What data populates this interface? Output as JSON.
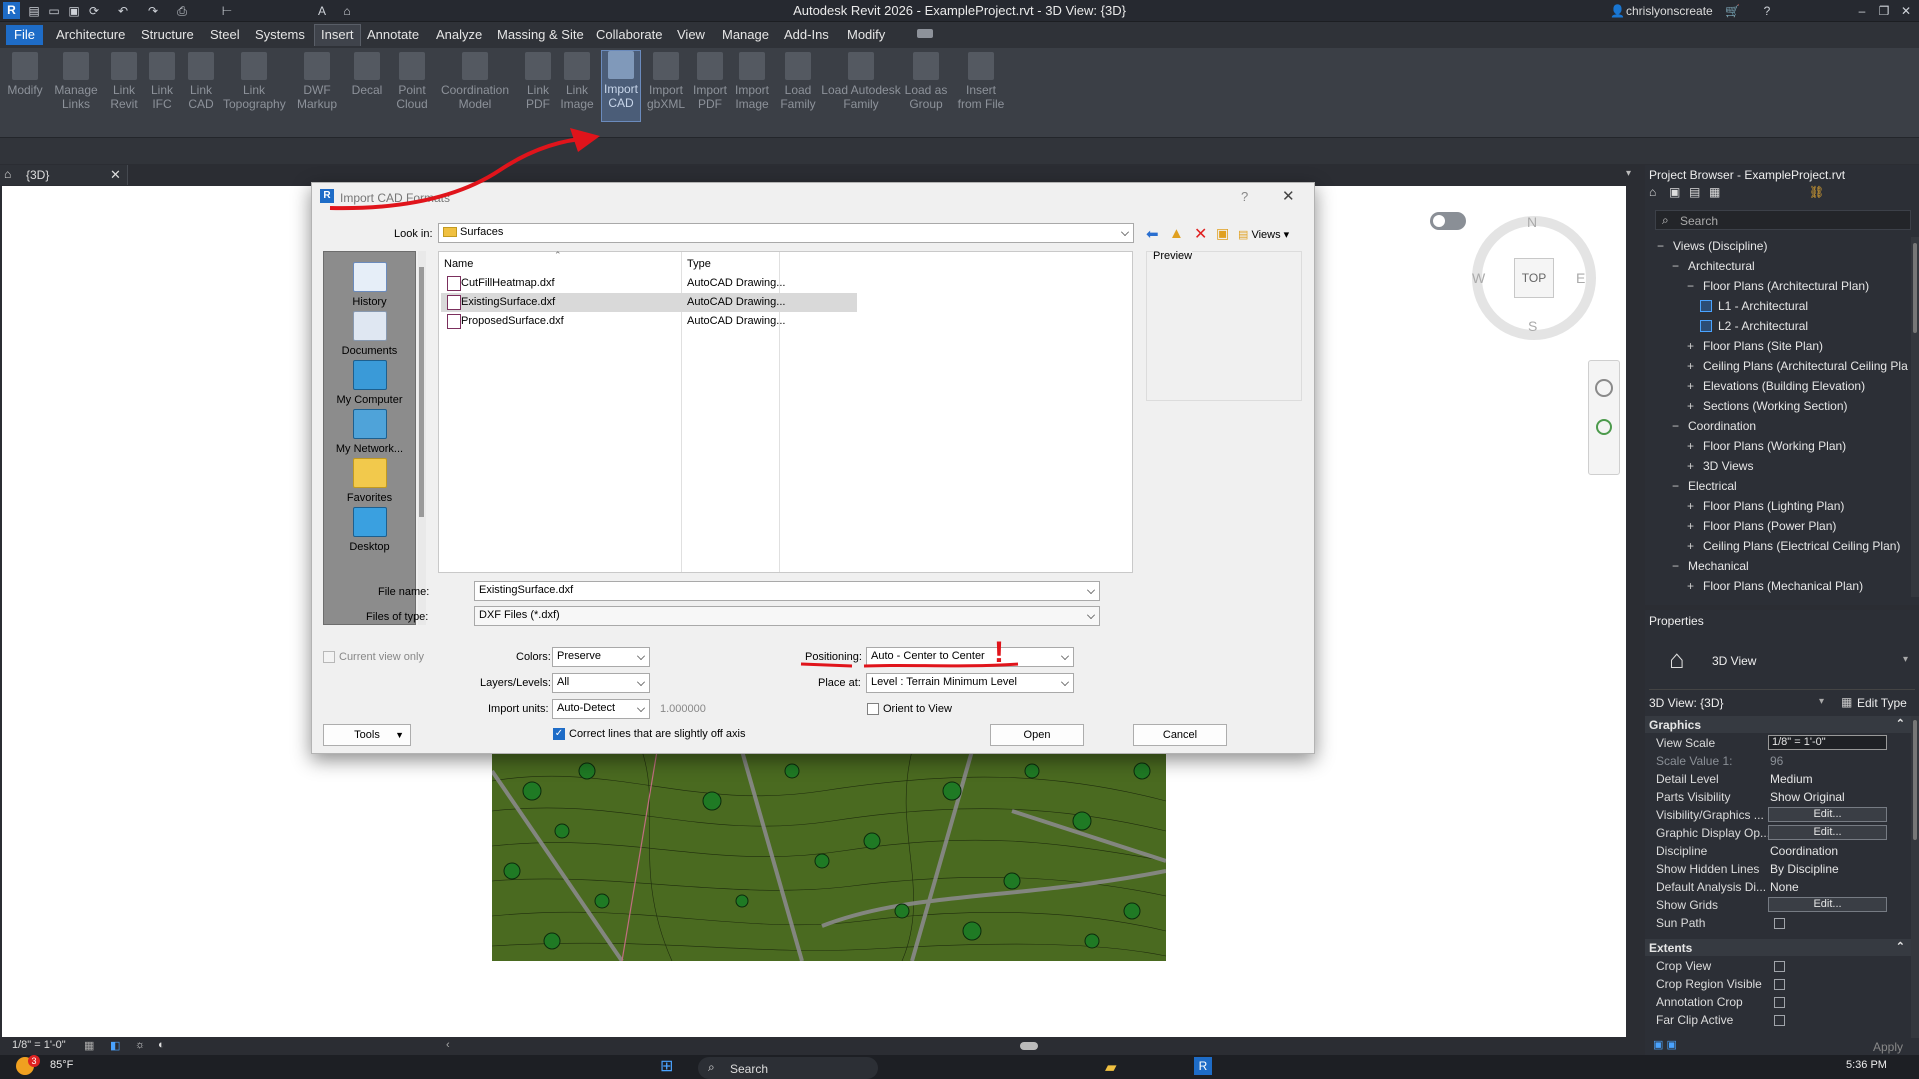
{
  "window": {
    "title": "Autodesk Revit 2026 - ExampleProject.rvt - 3D View: {3D}",
    "user": "chrislyonscreate"
  },
  "menu": [
    "File",
    "Architecture",
    "Structure",
    "Steel",
    "Systems",
    "Insert",
    "Annotate",
    "Analyze",
    "Massing & Site",
    "Collaborate",
    "View",
    "Manage",
    "Add-Ins",
    "Modify"
  ],
  "ribbon": [
    {
      "l1": "Modify",
      "l2": ""
    },
    {
      "l1": "Manage",
      "l2": "Links"
    },
    {
      "l1": "Link",
      "l2": "Revit"
    },
    {
      "l1": "Link",
      "l2": "IFC"
    },
    {
      "l1": "Link",
      "l2": "CAD"
    },
    {
      "l1": "Link",
      "l2": "Topography"
    },
    {
      "l1": "DWF",
      "l2": "Markup"
    },
    {
      "l1": "Decal",
      "l2": ""
    },
    {
      "l1": "Point",
      "l2": "Cloud"
    },
    {
      "l1": "Coordination",
      "l2": "Model"
    },
    {
      "l1": "Link",
      "l2": "PDF"
    },
    {
      "l1": "Link",
      "l2": "Image"
    },
    {
      "l1": "Import",
      "l2": "CAD"
    },
    {
      "l1": "Import",
      "l2": "gbXML"
    },
    {
      "l1": "Import",
      "l2": "PDF"
    },
    {
      "l1": "Import",
      "l2": "Image"
    },
    {
      "l1": "Load",
      "l2": "Family"
    },
    {
      "l1": "Load Autodesk",
      "l2": "Family"
    },
    {
      "l1": "Load as",
      "l2": "Group"
    },
    {
      "l1": "Insert",
      "l2": "from File"
    }
  ],
  "view_tab": "{3D}",
  "status_scale": "1/8\" = 1'-0\"",
  "viewcube": {
    "top": "TOP",
    "n": "N",
    "s": "S",
    "e": "E",
    "w": "W"
  },
  "dialog": {
    "title": "Import CAD Formats",
    "look_in_label": "Look in:",
    "look_in": "Surfaces",
    "views_label": "Views",
    "preview_label": "Preview",
    "places": [
      "History",
      "Documents",
      "My Computer",
      "My Network...",
      "Favorites",
      "Desktop"
    ],
    "col_name": "Name",
    "col_type": "Type",
    "files": [
      {
        "name": "CutFillHeatmap.dxf",
        "type": "AutoCAD Drawing..."
      },
      {
        "name": "ExistingSurface.dxf",
        "type": "AutoCAD Drawing..."
      },
      {
        "name": "ProposedSurface.dxf",
        "type": "AutoCAD Drawing..."
      }
    ],
    "file_name_label": "File name:",
    "file_name": "ExistingSurface.dxf",
    "files_type_label": "Files of type:",
    "files_type": "DXF Files (*.dxf)",
    "current_view_only": "Current view only",
    "colors_label": "Colors:",
    "colors": "Preserve",
    "layers_label": "Layers/Levels:",
    "layers": "All",
    "units_label": "Import units:",
    "units": "Auto-Detect",
    "units_factor": "1.000000",
    "correct_lines": "Correct lines that are slightly off axis",
    "positioning_label": "Positioning:",
    "positioning": "Auto - Center to Center",
    "place_at_label": "Place at:",
    "place_at": "Level : Terrain Minimum Level",
    "orient_label": "Orient to View",
    "tools": "Tools",
    "open": "Open",
    "cancel": "Cancel",
    "annotation": "!"
  },
  "project_browser": {
    "title": "Project Browser - ExampleProject.rvt",
    "search_placeholder": "Search",
    "tree": [
      {
        "t": "Views (Discipline)",
        "lvl": 0,
        "sym": "−"
      },
      {
        "t": "Architectural",
        "lvl": 1,
        "sym": "−"
      },
      {
        "t": "Floor Plans (Architectural Plan)",
        "lvl": 2,
        "sym": "−"
      },
      {
        "t": "L1 - Architectural",
        "lvl": 3,
        "sym": ""
      },
      {
        "t": "L2 - Architectural",
        "lvl": 3,
        "sym": ""
      },
      {
        "t": "Floor Plans (Site Plan)",
        "lvl": 2,
        "sym": "+"
      },
      {
        "t": "Ceiling Plans (Architectural Ceiling Pla",
        "lvl": 2,
        "sym": "+"
      },
      {
        "t": "Elevations (Building Elevation)",
        "lvl": 2,
        "sym": "+"
      },
      {
        "t": "Sections (Working Section)",
        "lvl": 2,
        "sym": "+"
      },
      {
        "t": "Coordination",
        "lvl": 1,
        "sym": "−"
      },
      {
        "t": "Floor Plans (Working Plan)",
        "lvl": 2,
        "sym": "+"
      },
      {
        "t": "3D Views",
        "lvl": 2,
        "sym": "+"
      },
      {
        "t": "Electrical",
        "lvl": 1,
        "sym": "−"
      },
      {
        "t": "Floor Plans (Lighting Plan)",
        "lvl": 2,
        "sym": "+"
      },
      {
        "t": "Floor Plans (Power Plan)",
        "lvl": 2,
        "sym": "+"
      },
      {
        "t": "Ceiling Plans (Electrical Ceiling Plan)",
        "lvl": 2,
        "sym": "+"
      },
      {
        "t": "Mechanical",
        "lvl": 1,
        "sym": "−"
      },
      {
        "t": "Floor Plans (Mechanical Plan)",
        "lvl": 2,
        "sym": "+"
      }
    ]
  },
  "properties": {
    "title": "Properties",
    "type_name": "3D View",
    "selector": "3D View: {3D}",
    "edit_type": "Edit Type",
    "graphics_head": "Graphics",
    "rows": [
      {
        "label": "View Scale",
        "val": "1/8\" = 1'-0\"",
        "kind": "field"
      },
      {
        "label": "Scale Value    1:",
        "val": "96",
        "kind": "dim"
      },
      {
        "label": "Detail Level",
        "val": "Medium",
        "kind": "text"
      },
      {
        "label": "Parts Visibility",
        "val": "Show Original",
        "kind": "text"
      },
      {
        "label": "Visibility/Graphics ...",
        "val": "Edit...",
        "kind": "btn"
      },
      {
        "label": "Graphic Display Op...",
        "val": "Edit...",
        "kind": "btn"
      },
      {
        "label": "Discipline",
        "val": "Coordination",
        "kind": "text"
      },
      {
        "label": "Show Hidden Lines",
        "val": "By Discipline",
        "kind": "text"
      },
      {
        "label": "Default Analysis Di...",
        "val": "None",
        "kind": "text"
      },
      {
        "label": "Show Grids",
        "val": "Edit...",
        "kind": "btn"
      },
      {
        "label": "Sun Path",
        "val": "",
        "kind": "cb"
      }
    ],
    "extents_head": "Extents",
    "extents": [
      {
        "label": "Crop View"
      },
      {
        "label": "Crop Region Visible"
      },
      {
        "label": "Annotation Crop"
      },
      {
        "label": "Far Clip Active"
      }
    ],
    "apply": "Apply"
  },
  "taskbar": {
    "weather": "85°F",
    "search": "Search",
    "time": "5:36 PM",
    "badge": "3"
  },
  "colors": {
    "accent": "#1e6cc7",
    "annotation_red": "#e0141b",
    "terrain": "#4a6a20"
  }
}
